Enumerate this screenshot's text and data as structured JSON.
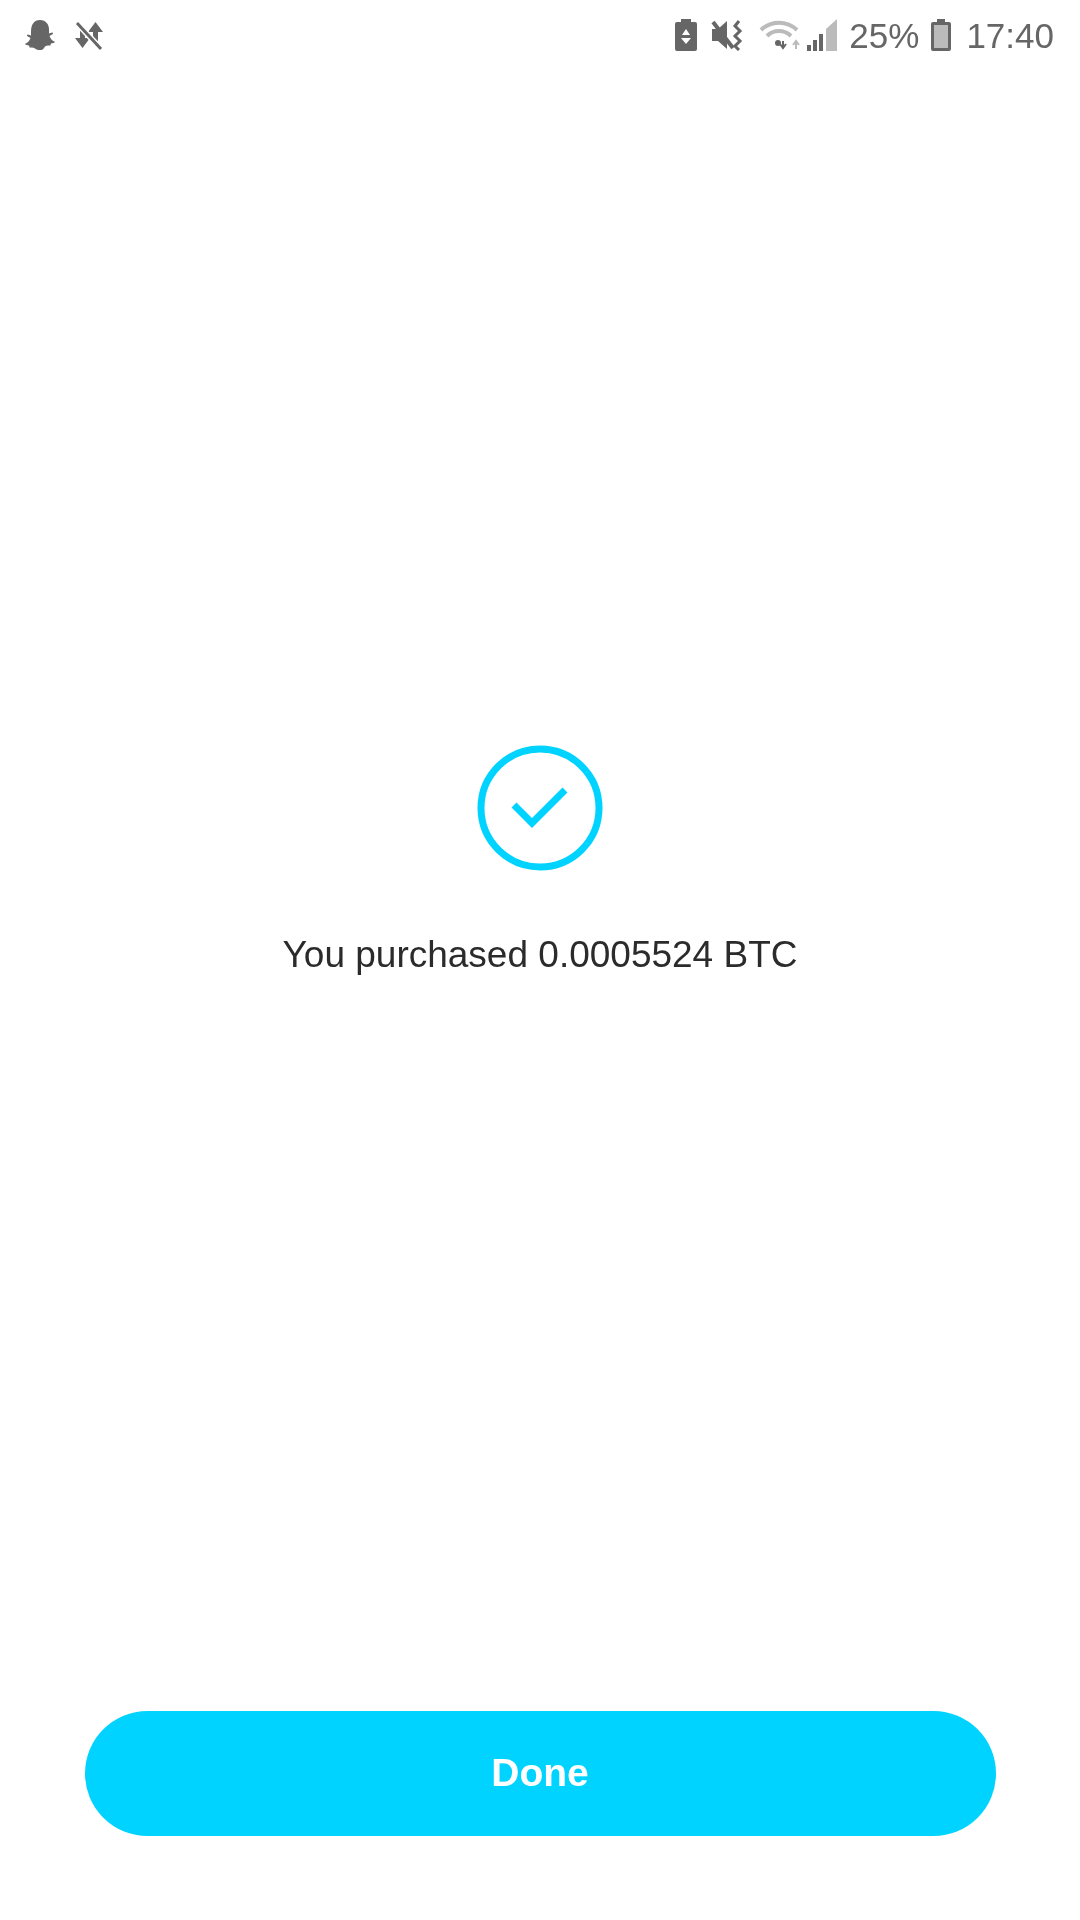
{
  "status_bar": {
    "battery": "25%",
    "time": "17:40"
  },
  "message": "You purchased 0.0005524 BTC",
  "button": {
    "label": "Done"
  }
}
